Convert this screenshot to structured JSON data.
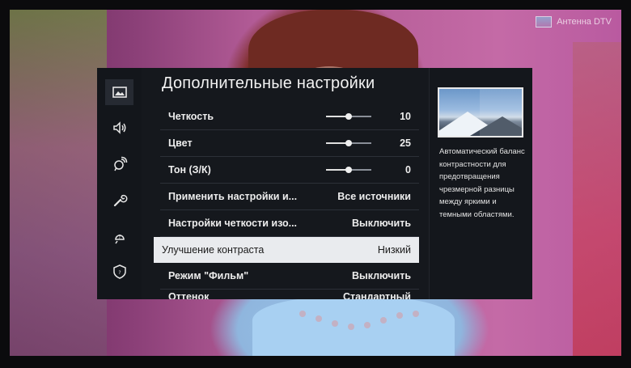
{
  "channel": {
    "name": "Антенна DTV"
  },
  "menu": {
    "title": "Дополнительные настройки",
    "rail": [
      {
        "icon": "picture-icon",
        "active": true
      },
      {
        "icon": "sound-icon",
        "active": false
      },
      {
        "icon": "broadcast-icon",
        "active": false
      },
      {
        "icon": "wrench-icon",
        "active": false
      },
      {
        "icon": "support-icon",
        "active": false
      },
      {
        "icon": "privacy-shield-icon",
        "active": false
      }
    ],
    "rows": [
      {
        "label": "Четкость",
        "value": "10",
        "slider": 0.5
      },
      {
        "label": "Цвет",
        "value": "25",
        "slider": 0.5
      },
      {
        "label": "Тон (З/К)",
        "value": "0",
        "slider": 0.5
      },
      {
        "label": "Применить настройки и...",
        "value": "Все источники"
      },
      {
        "label": "Настройки четкости изо...",
        "value": "Выключить"
      },
      {
        "label": "Улучшение контраста",
        "value": "Низкий",
        "selected": true
      },
      {
        "label": "Режим \"Фильм\"",
        "value": "Выключить"
      },
      {
        "label": "Оттенок",
        "value": "Стандартный"
      }
    ],
    "help": {
      "description": "Автоматический баланс контрастности для предотвращения чрезмерной разницы между яркими и темными областями."
    }
  }
}
